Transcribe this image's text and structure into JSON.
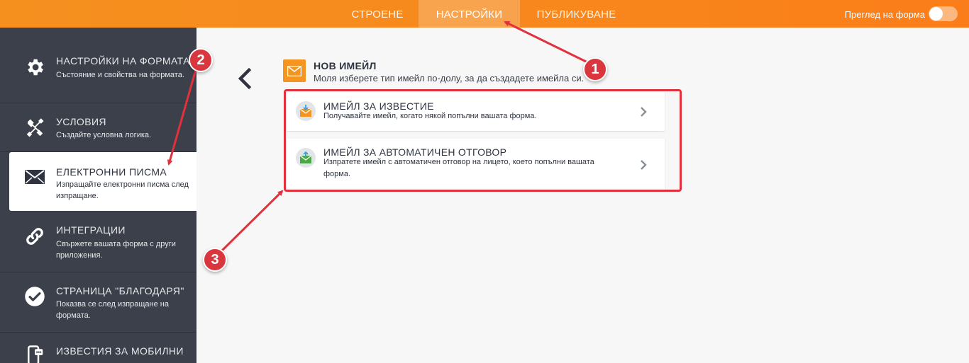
{
  "topbar": {
    "tabs": [
      {
        "label": "СТРОЕНЕ"
      },
      {
        "label": "НАСТРОЙКИ"
      },
      {
        "label": "ПУБЛИКУВАНЕ"
      }
    ],
    "preview_label": "Преглед на форма"
  },
  "sidebar": {
    "items": [
      {
        "title": "НАСТРОЙКИ НА ФОРМАТА",
        "desc": "Състояние и свойства на формата.",
        "icon": "gear-icon"
      },
      {
        "title": "УСЛОВИЯ",
        "desc": "Създайте условна логика.",
        "icon": "tools-icon"
      },
      {
        "title": "ЕЛЕКТРОННИ ПИСМА",
        "desc": "Изпращайте електронни писма след изпращане.",
        "icon": "envelope-icon"
      },
      {
        "title": "ИНТЕГРАЦИИ",
        "desc": "Свържете вашата форма с други приложения.",
        "icon": "link-icon"
      },
      {
        "title": "СТРАНИЦА \"БЛАГОДАРЯ\"",
        "desc": "Показва се след изпращане на формата.",
        "icon": "check-circle-icon"
      },
      {
        "title": "ИЗВЕСТИЯ ЗА МОБИЛНИ",
        "desc": "",
        "icon": "mobile-notification-icon"
      }
    ]
  },
  "main": {
    "title": "НОВ ИМЕЙЛ",
    "subtitle": "Моля изберете тип имейл по-долу, за да създадете имейла си.",
    "cards": [
      {
        "title": "ИМЕЙЛ ЗА ИЗВЕСТИЕ",
        "desc": "Получавайте имейл, когато някой попълни вашата форма."
      },
      {
        "title": "ИМЕЙЛ ЗА АВТОМАТИЧЕН ОТГОВОР",
        "desc": "Изпратете имейл с автоматичен отговор на лицето, което попълни вашата форма."
      }
    ]
  },
  "annotations": {
    "badges": [
      "1",
      "2",
      "3"
    ],
    "color": "#e0313d"
  },
  "colors": {
    "accent": "#f7891d",
    "sidebar": "#3c404a"
  }
}
